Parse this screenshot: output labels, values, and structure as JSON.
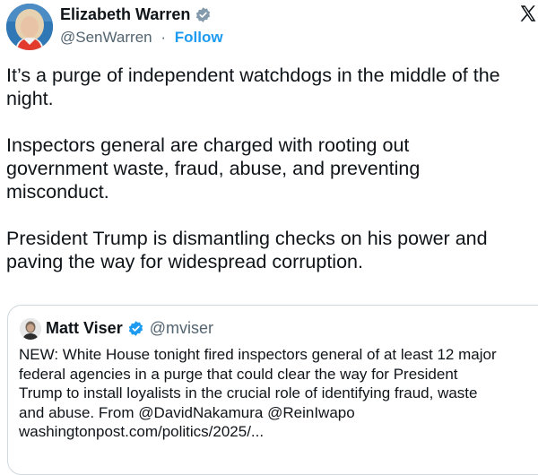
{
  "author": {
    "name": "Elizabeth Warren",
    "handle": "@SenWarren",
    "separator": "·",
    "follow_label": "Follow",
    "avatar_icon": "profile-photo",
    "verified_icon": "verified-badge-icon"
  },
  "platform_icon": "x-logo-icon",
  "tweet": {
    "paragraphs": [
      [
        "It’s a purge of independent watchdogs in the middle of the",
        "night."
      ],
      [
        "Inspectors general are charged with rooting out",
        "government waste, fraud, abuse, and preventing",
        "misconduct."
      ],
      [
        "President Trump is dismantling checks on his power and",
        "paving the way for widespread corruption."
      ]
    ]
  },
  "quote": {
    "author_name": "Matt Viser",
    "author_handle": "@mviser",
    "lines": [
      "NEW: White House tonight fired inspectors general of at least 12 major",
      "federal agencies in a purge that could clear the way for President",
      "Trump to install loyalists in the crucial role of identifying fraud, waste",
      "and abuse. From @DavidNakamura @ReinIwapo",
      "washingtonpost.com/politics/2025/..."
    ]
  },
  "colors": {
    "text": "#0f1419",
    "muted": "#536471",
    "accent": "#1d9bf0",
    "border": "#cfd9de"
  }
}
